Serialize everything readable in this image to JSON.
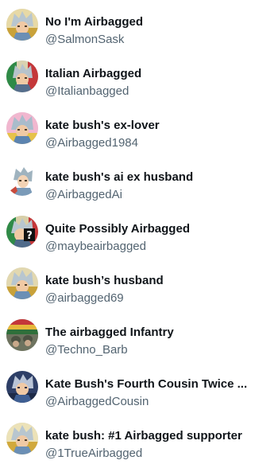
{
  "users": [
    {
      "name": "No I'm Airbagged",
      "handle": "@SalmonSask",
      "avatar_icon": "anime-character-avatar"
    },
    {
      "name": "Italian Airbagged",
      "handle": "@Italianbagged",
      "avatar_icon": "italian-flag-anime-character-avatar"
    },
    {
      "name": "kate bush's ex-lover",
      "handle": "@Airbagged1984",
      "avatar_icon": "pink-anime-character-avatar"
    },
    {
      "name": "kate bush's ai ex husband",
      "handle": "@AirbaggedAi",
      "avatar_icon": "ai-anime-character-avatar"
    },
    {
      "name": "Quite Possibly Airbagged",
      "handle": "@maybeairbagged",
      "avatar_icon": "question-mark-anime-character-avatar"
    },
    {
      "name": "kate bush’s husband",
      "handle": "@airbagged69",
      "avatar_icon": "anime-character-avatar"
    },
    {
      "name": "The airbagged Infantry",
      "handle": "@Techno_Barb",
      "avatar_icon": "soldiers-flag-avatar"
    },
    {
      "name": "Kate Bush's Fourth Cousin Twice ...",
      "handle": "@AirbaggedCousin",
      "avatar_icon": "blue-anime-character-avatar"
    },
    {
      "name": "kate bush: #1 Airbagged supporter",
      "handle": "@1TrueAirbagged",
      "avatar_icon": "anime-character-avatar"
    }
  ]
}
